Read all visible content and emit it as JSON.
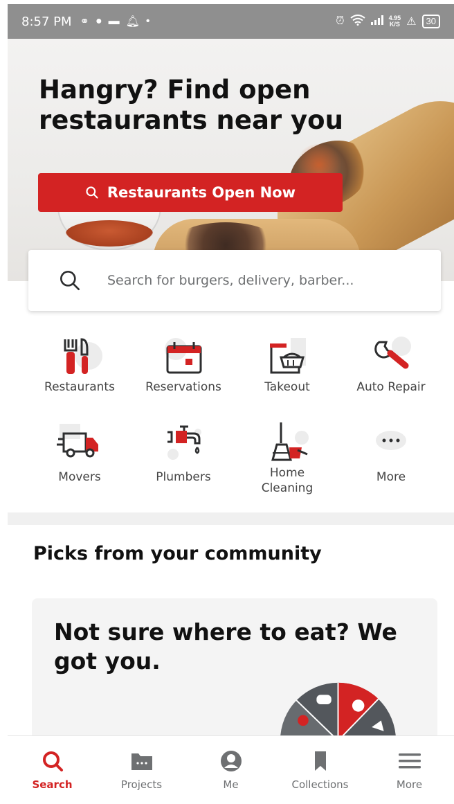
{
  "status_bar": {
    "time": "8:57 PM",
    "net_speed_value": "4.95",
    "net_speed_unit": "K/S",
    "battery": "30"
  },
  "hero": {
    "title": "Hangry? Find open restaurants near you",
    "button_label": "Restaurants Open Now"
  },
  "search": {
    "placeholder": "Search for burgers, delivery, barber..."
  },
  "categories": [
    {
      "label": "Restaurants",
      "icon": "utensils-icon"
    },
    {
      "label": "Reservations",
      "icon": "calendar-icon"
    },
    {
      "label": "Takeout",
      "icon": "takeout-bag-icon"
    },
    {
      "label": "Auto Repair",
      "icon": "wrench-icon"
    },
    {
      "label": "Movers",
      "icon": "moving-truck-icon"
    },
    {
      "label": "Plumbers",
      "icon": "faucet-icon"
    },
    {
      "label": "Home Cleaning",
      "icon": "broom-icon"
    },
    {
      "label": "More",
      "icon": "more-dots-icon"
    }
  ],
  "community": {
    "section_title": "Picks from your community",
    "card_title": "Not sure where to eat? We got you."
  },
  "bottom_nav": [
    {
      "label": "Search",
      "icon": "search-icon",
      "active": true
    },
    {
      "label": "Projects",
      "icon": "folder-icon",
      "active": false
    },
    {
      "label": "Me",
      "icon": "profile-icon",
      "active": false
    },
    {
      "label": "Collections",
      "icon": "bookmark-icon",
      "active": false
    },
    {
      "label": "More",
      "icon": "menu-icon",
      "active": false
    }
  ],
  "colors": {
    "brand_red": "#d32323",
    "text_dark": "#111111",
    "text_gray": "#6e7072"
  }
}
